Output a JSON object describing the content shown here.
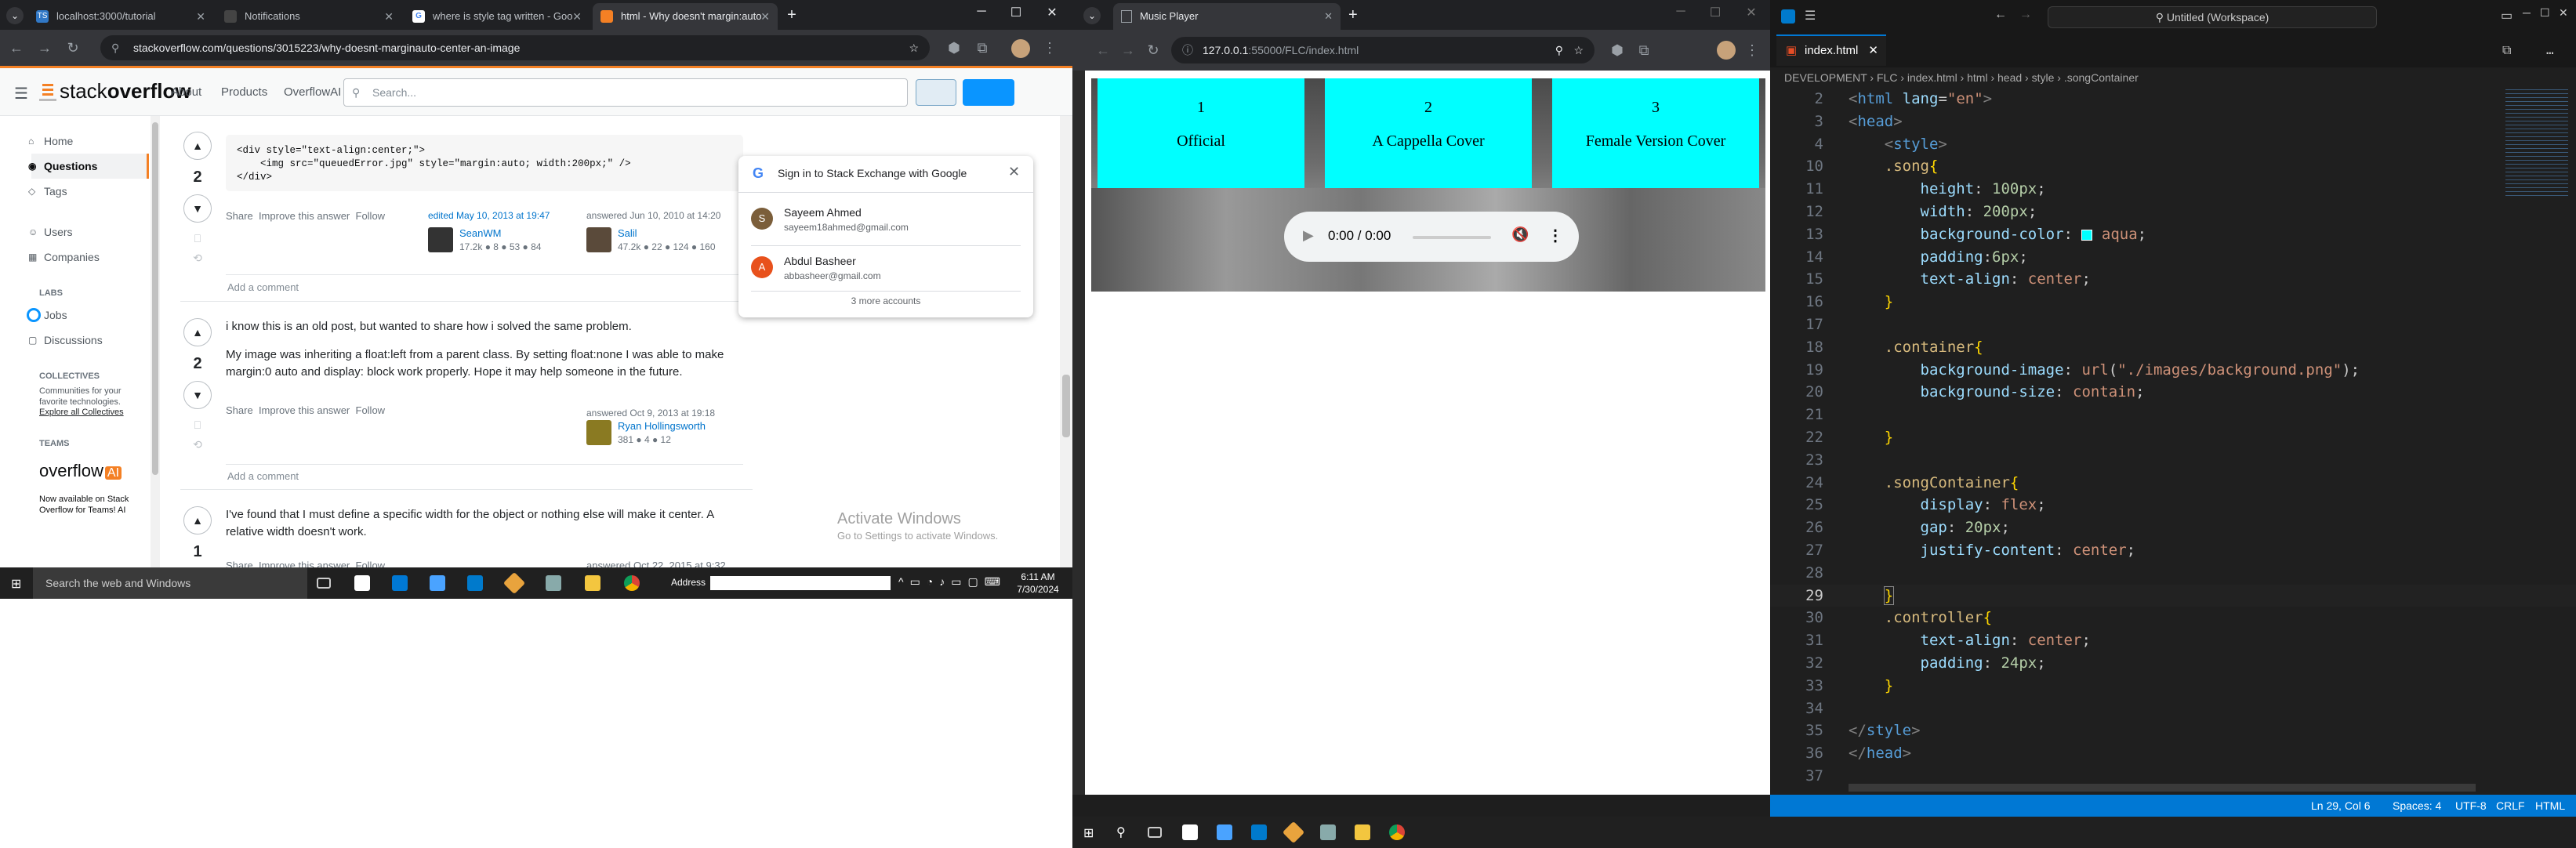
{
  "left_browser": {
    "tabs": [
      {
        "icon": "TS",
        "title": "localhost:3000/tutorial"
      },
      {
        "icon": "",
        "title": "Notifications"
      },
      {
        "icon": "G",
        "title": "where is style tag written - Goo"
      },
      {
        "icon": "",
        "title": "html - Why doesn't margin:auto"
      }
    ],
    "url": "stackoverflow.com/questions/3015223/why-doesnt-marginauto-center-an-image",
    "so": {
      "logo_a": "stack",
      "logo_b": "overflow",
      "nav": [
        "About",
        "Products",
        "OverflowAI"
      ],
      "search_placeholder": "Search...",
      "sidebar": {
        "items": [
          "Home",
          "Questions",
          "Tags",
          "Users",
          "Companies"
        ],
        "labs_header": "LABS",
        "labs": [
          "Jobs",
          "Discussions"
        ],
        "collectives_header": "COLLECTIVES",
        "collectives_text": "Communities for your favorite technologies.",
        "collectives_link": "Explore all Collectives",
        "teams_header": "TEAMS",
        "teams_logo": "overflow",
        "teams_ai": "AI",
        "teams_text": "Now available on Stack Overflow for Teams! AI"
      },
      "code_lines": [
        "<div style=\"text-align:center;\">",
        "    <img src=\"queuedError.jpg\" style=\"margin:auto; width:200px;\" />",
        "</div>"
      ],
      "answer1": {
        "votes": "2",
        "actions": [
          "Share",
          "Improve this answer",
          "Follow"
        ],
        "edited": "edited May 10, 2013 at 19:47",
        "editor": "SeanWM",
        "editor_rep": "17.2k ● 8 ● 53 ● 84",
        "answered": "answered Jun 10, 2010 at 14:20",
        "author": "Salil",
        "author_rep": "47.2k ● 22 ● 124 ● 160",
        "add_comment": "Add a comment"
      },
      "answer2": {
        "votes": "2",
        "p1": "i know this is an old post, but wanted to share how i solved the same problem.",
        "p2": "My image was inheriting a float:left from a parent class. By setting float:none I was able to make margin:0 auto and display: block work properly. Hope it may help someone in the future.",
        "actions": [
          "Share",
          "Improve this answer",
          "Follow"
        ],
        "answered": "answered Oct 9, 2013 at 19:18",
        "author": "Ryan Hollingsworth",
        "author_rep": "381 ● 4 ● 12",
        "add_comment": "Add a comment"
      },
      "answer3": {
        "votes": "1",
        "p1": "I've found that I must define a specific width for the object or nothing else will make it center. A relative width doesn't work.",
        "actions": [
          "Share",
          "Improve this answer",
          "Follow"
        ],
        "answered": "answered Oct 22, 2015 at 9:32"
      },
      "google_popup": {
        "title": "Sign in to Stack Exchange with Google",
        "accounts": [
          {
            "initial": "S",
            "name": "Sayeem Ahmed",
            "email": "sayeem18ahmed@gmail.com",
            "color": "#7b5e3a"
          },
          {
            "initial": "A",
            "name": "Abdul Basheer",
            "email": "abbasheer@gmail.com",
            "color": "#e8511c"
          }
        ],
        "more": "3 more accounts"
      },
      "activate_title": "Activate Windows",
      "activate_sub": "Go to Settings to activate Windows."
    },
    "taskbar": {
      "search": "Search the web and Windows",
      "address_label": "Address",
      "time": "6:11 AM",
      "date": "7/30/2024"
    }
  },
  "middle_browser": {
    "tab": "Music Player",
    "url_host": "127.0.0.1",
    "url_rest": ":55000/FLC/index.html",
    "songs": [
      {
        "num": "1",
        "title": "Official"
      },
      {
        "num": "2",
        "title": "A Cappella Cover"
      },
      {
        "num": "3",
        "title": "Female Version Cover"
      }
    ],
    "player_time": "0:00 / 0:00"
  },
  "vscode": {
    "title": "Untitled (Workspace)",
    "tab": "index.html",
    "breadcrumb": "DEVELOPMENT › FLC › index.html › html › head › style › .songContainer",
    "status": {
      "pos": "Ln 29, Col 6",
      "spaces": "Spaces: 4",
      "enc": "UTF-8",
      "eol": "CRLF",
      "lang": "HTML"
    }
  }
}
